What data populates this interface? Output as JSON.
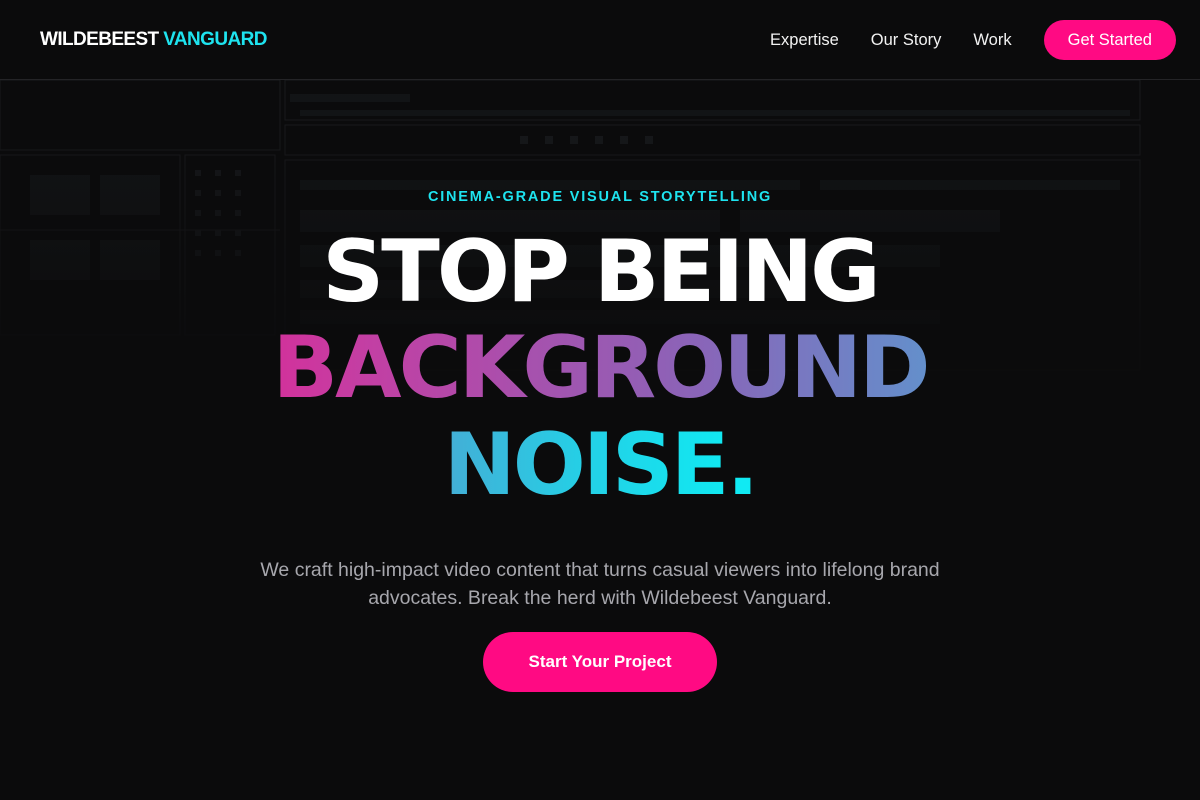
{
  "header": {
    "logo_primary": "WILDEBEEST",
    "logo_accent": "VANGUARD",
    "nav": [
      "Expertise",
      "Our Story",
      "Work"
    ],
    "cta_label": "Get Started"
  },
  "hero": {
    "eyebrow": "CINEMA-GRADE VISUAL STORYTELLING",
    "headline_line1": "STOP BEING",
    "headline_line2": "BACKGROUND",
    "headline_line3": "NOISE",
    "headline_punctuation": ".",
    "subtext": "We craft high-impact video content that turns casual viewers into lifelong brand advocates. Break the herd with Wildebeest Vanguard.",
    "cta_label": "Start Your Project"
  },
  "colors": {
    "background": "#0b0b0c",
    "brand_pink": "#ff0a83",
    "brand_cyan": "#1ee3ef",
    "body_text": "#a7a7ad",
    "white": "#ffffff"
  },
  "background_image": "dark video-editing software interface (faded)"
}
